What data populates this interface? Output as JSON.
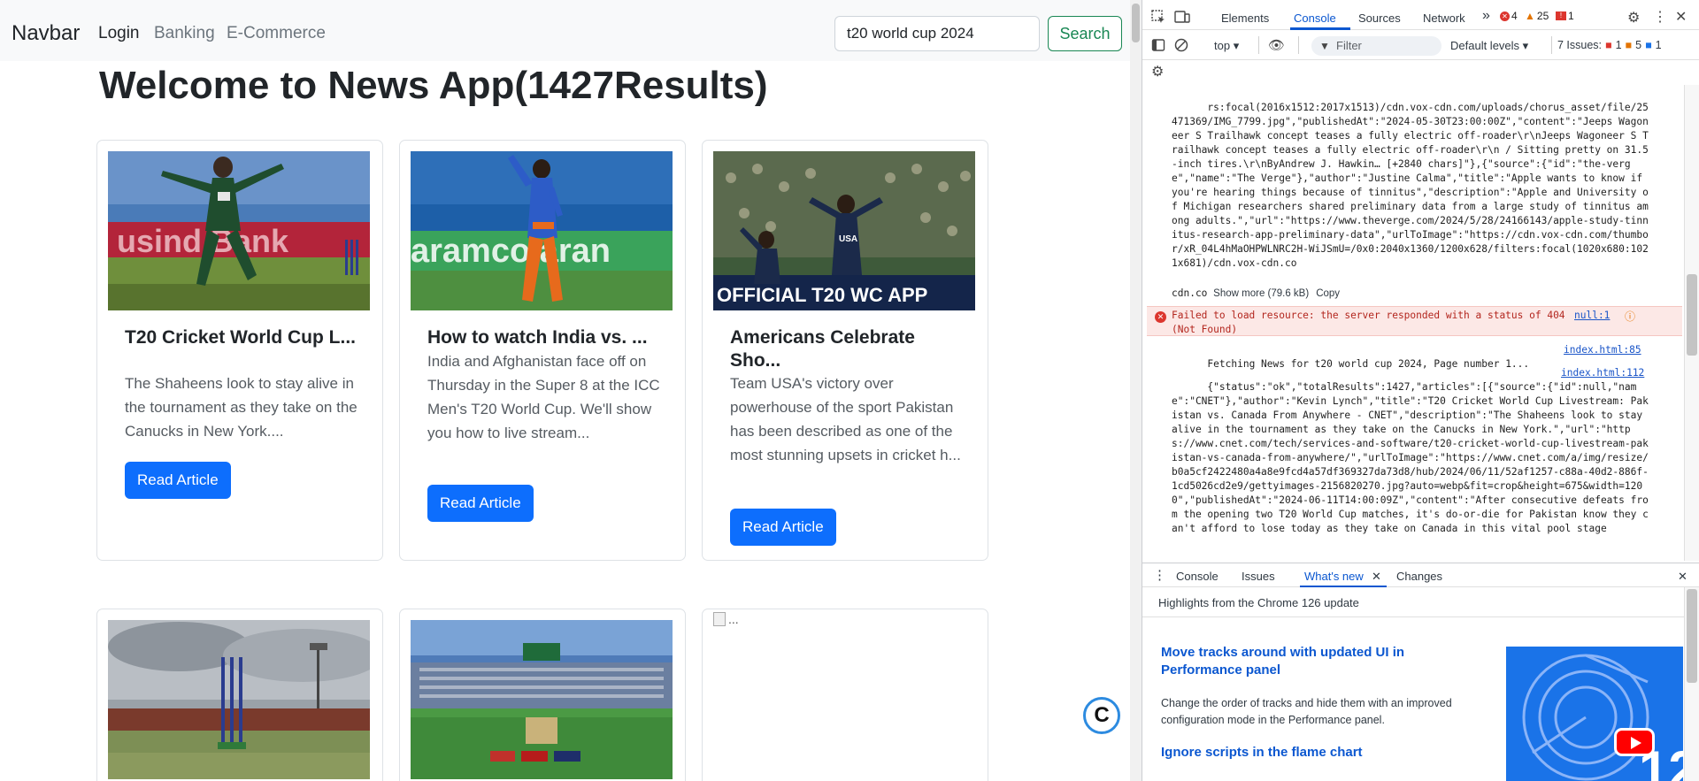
{
  "navbar": {
    "brand": "Navbar",
    "links": [
      "Login",
      "Banking",
      "E-Commerce"
    ],
    "search_value": "t20 world cup 2024",
    "search_button": "Search"
  },
  "heading": "Welcome to News App(1427Results)",
  "cards": [
    {
      "title": "T20 Cricket World Cup L...",
      "text": "The Shaheens look to stay alive in the tournament as they take on the Canucks in New York....",
      "button": "Read Article"
    },
    {
      "title": "How to watch India vs. ...",
      "text": "India and Afghanistan face off on Thursday in the Super 8 at the ICC Men's T20 World Cup. We'll show you how to live stream...",
      "button": "Read Article"
    },
    {
      "title": "Americans Celebrate Sho...",
      "text": "Team USA's victory over powerhouse of the sport Pakistan has been described as one of the most stunning upsets in cricket h...",
      "button": "Read Article"
    }
  ],
  "broken_image_alt": "...",
  "floating_logo": "C",
  "devtools": {
    "tabs": [
      "Elements",
      "Console",
      "Sources",
      "Network"
    ],
    "more_tabs": "»",
    "errors_count": "4",
    "warnings_count": "25",
    "info_count": "1",
    "context": "top",
    "filter_placeholder": "Filter",
    "levels": "Default levels",
    "issues_label": "7 Issues:",
    "issues_err": "1",
    "issues_warn": "5",
    "issues_info": "1",
    "log_top": "rs:focal(2016x1512:2017x1513)/cdn.vox-cdn.com/uploads/chorus_asset/file/25471369/IMG_7799.jpg\",\"publishedAt\":\"2024-05-30T23:00:00Z\",\"content\":\"Jeeps Wagoneer S Trailhawk concept teases a fully electric off-roader\\r\\nJeeps Wagoneer S Trailhawk concept teases a fully electric off-roader\\r\\n / Sitting pretty on 31.5-inch tires.\\r\\nByAndrew J. Hawkin… [+2840 chars]\"},{\"source\":{\"id\":\"the-verge\",\"name\":\"The Verge\"},\"author\":\"Justine Calma\",\"title\":\"Apple wants to know if you're hearing things because of tinnitus\",\"description\":\"Apple and University of Michigan researchers shared preliminary data from a large study of tinnitus among adults.\",\"url\":\"https://www.theverge.com/2024/5/28/24166143/apple-study-tinnitus-research-app-preliminary-data\",\"urlToImage\":\"https://cdn.vox-cdn.com/thumbor/xR_04L4hMaOHPWLNRC2H-WiJSmU=/0x0:2040x1360/1200x628/filters:focal(1020x680:1021x681)/cdn.vox-cdn.co",
    "show_more": "Show more (79.6 kB)",
    "copy": "Copy",
    "error_text": "Failed to load resource: the server responded with a status of 404 (Not Found)",
    "error_link": "null:1",
    "fetch_text": "Fetching News for t20 world cup 2024, Page number 1...",
    "fetch_link": "index.html:85",
    "log2_link": "index.html:112",
    "log_bottom": "{\"status\":\"ok\",\"totalResults\":1427,\"articles\":[{\"source\":{\"id\":null,\"name\":\"CNET\"},\"author\":\"Kevin Lynch\",\"title\":\"T20 Cricket World Cup Livestream: Pakistan vs. Canada From Anywhere - CNET\",\"description\":\"The Shaheens look to stay alive in the tournament as they take on the Canucks in New York.\",\"url\":\"https://www.cnet.com/tech/services-and-software/t20-cricket-world-cup-livestream-pakistan-vs-canada-from-anywhere/\",\"urlToImage\":\"https://www.cnet.com/a/img/resize/b0a5cf2422480a4a8e9fcd4a57df369327da73d8/hub/2024/06/11/52af1257-c88a-40d2-886f-1cd5026cd2e9/gettyimages-2156820270.jpg?auto=webp&fit=crop&height=675&width=1200\",\"publishedAt\":\"2024-06-11T14:00:09Z\",\"content\":\"After consecutive defeats from the opening two T20 World Cup matches, it's do-or-die for Pakistan know they can't afford to lose today as they take on Canada in this vital pool stage",
    "drawer_tabs": [
      "Console",
      "Issues",
      "What's new",
      "Changes"
    ],
    "highlights": "Highlights from the Chrome 126 update",
    "whats_new_1_title": "Move tracks around with updated UI in Performance panel",
    "whats_new_1_desc": "Change the order of tracks and hide them with an improved configuration mode in the Performance panel.",
    "whats_new_2_title": "Ignore scripts in the flame chart"
  },
  "colors": {
    "primary": "#0d6efd",
    "success": "#198754",
    "devtools_accent": "#0b57d0",
    "error": "#dc362e",
    "warning": "#e37400"
  }
}
